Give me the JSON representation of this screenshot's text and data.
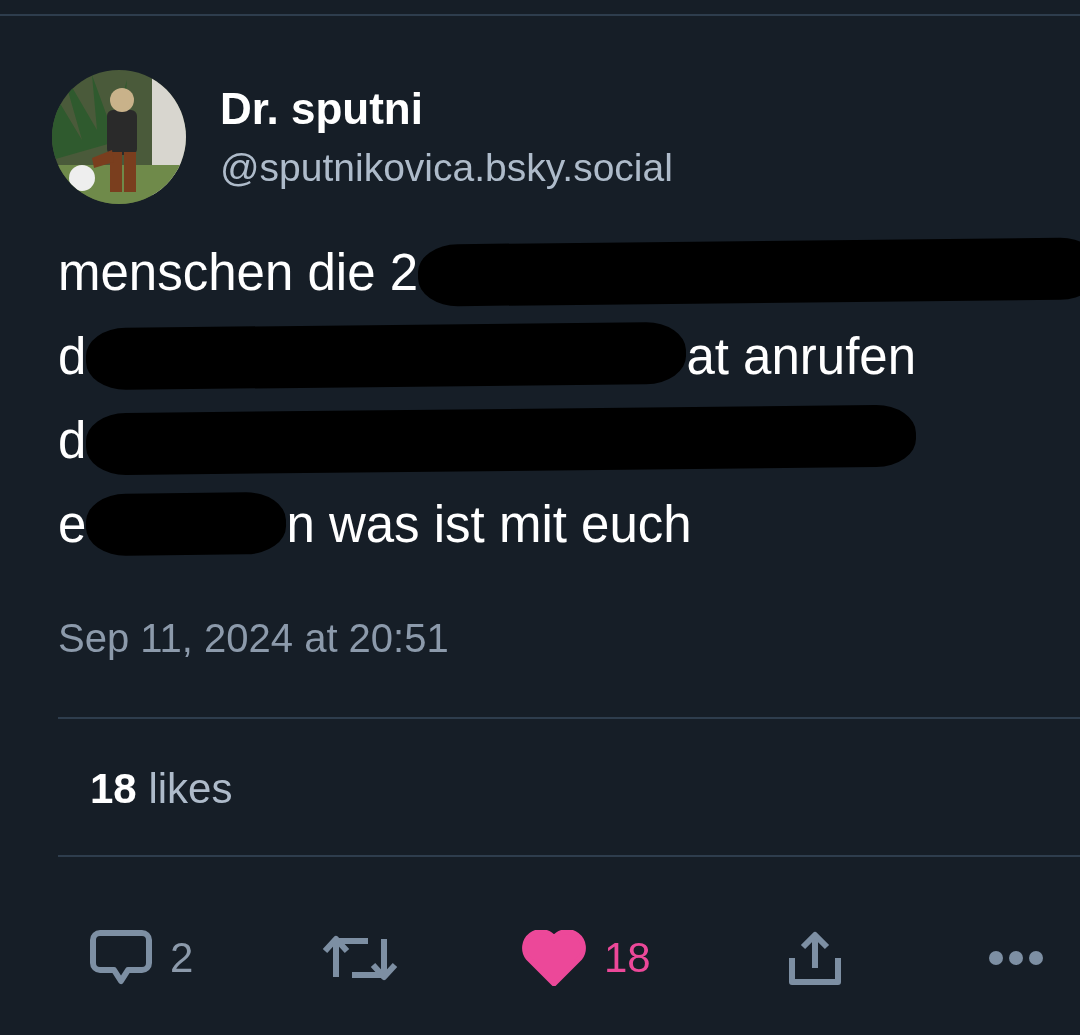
{
  "post": {
    "author": {
      "name": "Dr. sputni",
      "handle": "@sputnikovica.bsky.social"
    },
    "body_lines": [
      [
        {
          "kind": "text",
          "text": "menschen die 2"
        },
        {
          "kind": "redacted"
        }
      ],
      [
        {
          "kind": "text",
          "text": "d"
        },
        {
          "kind": "redacted"
        },
        {
          "kind": "text",
          "text": "at anrufen"
        }
      ],
      [
        {
          "kind": "text",
          "text": "d"
        },
        {
          "kind": "redacted"
        }
      ],
      [
        {
          "kind": "text",
          "text": "e"
        },
        {
          "kind": "redacted"
        },
        {
          "kind": "text",
          "text": "n was ist mit euch"
        }
      ]
    ],
    "timestamp": "Sep 11, 2024 at 20:51",
    "likes": {
      "count": "18",
      "label": "likes"
    },
    "actions": {
      "reply_count": "2",
      "like_count": "18",
      "liked": true
    }
  }
}
